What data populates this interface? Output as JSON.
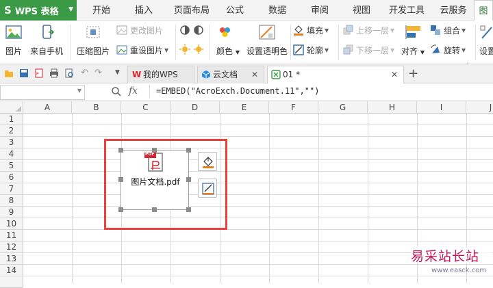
{
  "app": {
    "name": "WPS 表格"
  },
  "menu_tabs": [
    "开始",
    "插入",
    "页面布局",
    "公式",
    "数据",
    "审阅",
    "视图",
    "开发工具",
    "云服务",
    "图"
  ],
  "ribbon": {
    "picture": "图片",
    "from_phone": "来自手机",
    "compress": "压缩图片",
    "change_picture": "更改图片",
    "reset_picture": "重设图片",
    "color": "颜色",
    "set_transparent": "设置透明色",
    "fill": "填充",
    "outline": "轮廓",
    "bring_forward": "上移一层",
    "send_backward": "下移一层",
    "align": "对齐",
    "group": "组合",
    "rotate": "旋转",
    "settings": "设置"
  },
  "doc_tabs": [
    {
      "label": "我的WPS"
    },
    {
      "label": "云文档"
    },
    {
      "label": "01 *"
    }
  ],
  "formula_bar": {
    "fx": "fx",
    "formula": "=EMBED(\"AcroExch.Document.11\",\"\")"
  },
  "columns": [
    "A",
    "B",
    "C",
    "D",
    "E",
    "F",
    "G",
    "H",
    "I",
    "J"
  ],
  "rows": [
    "1",
    "2",
    "3",
    "4",
    "5",
    "6",
    "7",
    "8",
    "9",
    "10",
    "11",
    "12",
    "13",
    "14"
  ],
  "embedded_object": {
    "filename": "图片文档.pdf",
    "badge": "PDF"
  },
  "watermark": "易采站长站",
  "watermark_url": "www.easck.com",
  "colors": {
    "accent_green": "#3a9a46",
    "highlight_red": "#e8413c",
    "wps_red": "#d9232d"
  }
}
